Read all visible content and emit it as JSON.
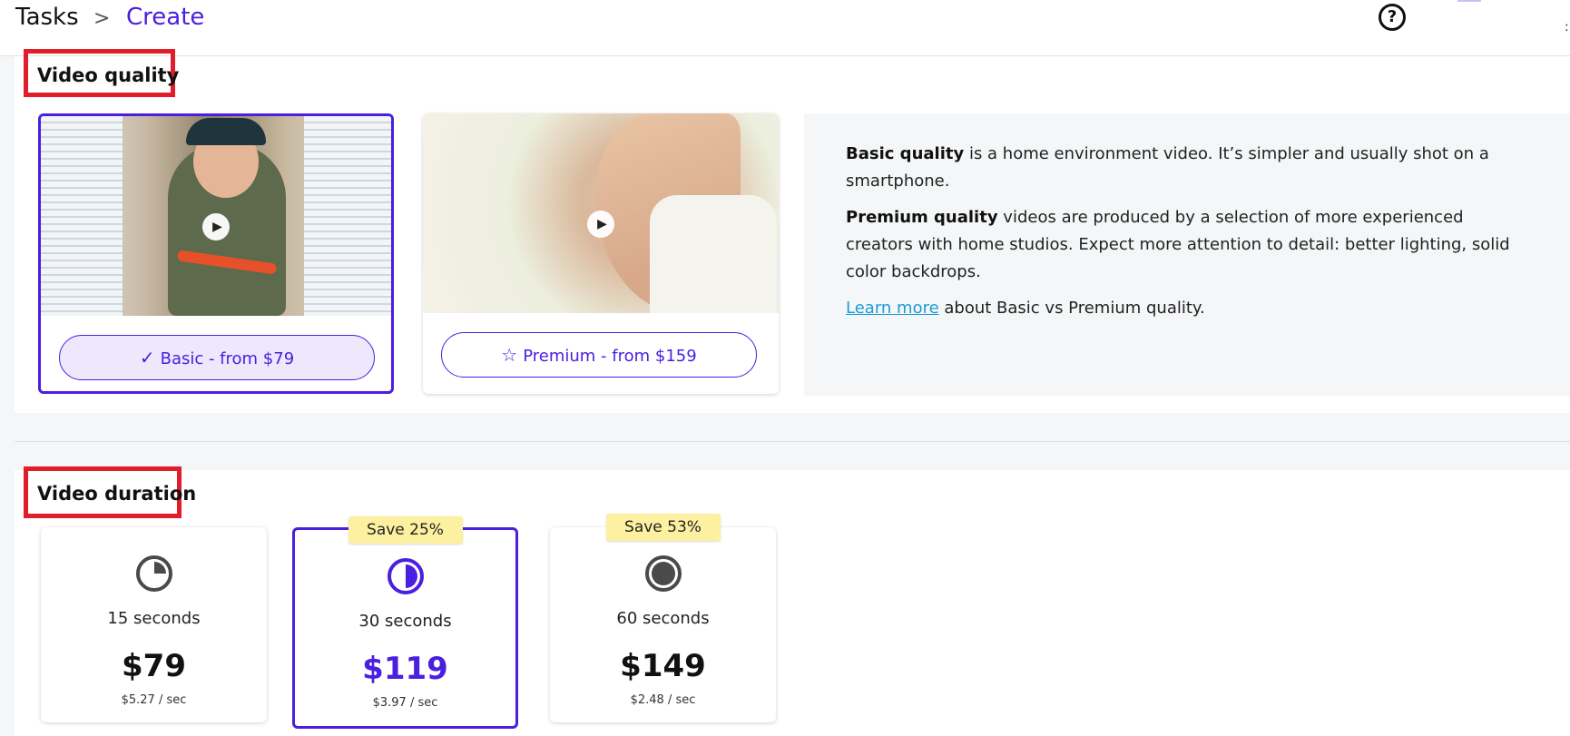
{
  "breadcrumb": {
    "root": "Tasks",
    "separator": ">",
    "current": "Create"
  },
  "header": {
    "help_icon": "help-circle-icon",
    "help_glyph": "?"
  },
  "quality": {
    "title": "Video quality",
    "options": [
      {
        "label": "Basic - from $79",
        "icon": "check-icon",
        "glyph": "✓",
        "selected": true
      },
      {
        "label": "Premium - from $159",
        "icon": "star-outline-icon",
        "glyph": "☆",
        "selected": false
      }
    ],
    "info": {
      "basic_bold": "Basic quality",
      "basic_text": " is a home environment video. It’s simpler and usually shot on a smartphone.",
      "premium_bold": "Premium quality",
      "premium_text": " videos are produced by a selection of more experienced creators with home studios. Expect more attention to detail: better lighting, solid color backdrops.",
      "link": "Learn more",
      "link_rest": " about Basic vs Premium quality."
    }
  },
  "duration": {
    "title": "Video duration",
    "options": [
      {
        "label": "15 seconds",
        "price": "$79",
        "per_sec": "$5.27 / sec",
        "badge": "",
        "icon": "clock-quarter-icon",
        "fill_fraction": 0.25,
        "selected": false
      },
      {
        "label": "30 seconds",
        "price": "$119",
        "per_sec": "$3.97 / sec",
        "badge": "Save 25%",
        "icon": "clock-half-icon",
        "fill_fraction": 0.5,
        "selected": true
      },
      {
        "label": "60 seconds",
        "price": "$149",
        "per_sec": "$2.48 / sec",
        "badge": "Save 53%",
        "icon": "clock-full-icon",
        "fill_fraction": 1.0,
        "selected": false
      }
    ]
  },
  "colors": {
    "accent": "#4a1fe0",
    "badge": "#fdf0a0",
    "highlight_mark": "#e11d2a",
    "link": "#1a9cd8"
  }
}
